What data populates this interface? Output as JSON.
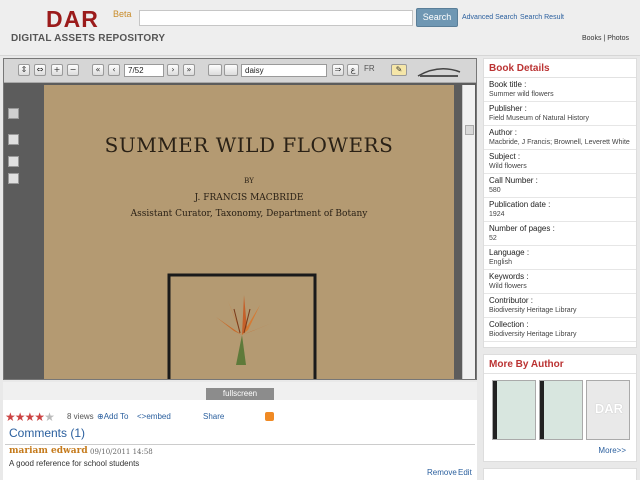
{
  "header": {
    "logo": "DAR",
    "beta": "Beta",
    "subtitle": "DIGITAL ASSETS REPOSITORY",
    "search_value": "",
    "search_button": "Search",
    "advanced_search": "Advanced Search",
    "search_result": "Search Result",
    "books_link": "Books",
    "separator": "|",
    "photos_link": "Photos"
  },
  "viewer": {
    "page_field": "7/52",
    "find_field": "daisy",
    "fr_label": "FR",
    "page": {
      "title": "SUMMER WILD FLOWERS",
      "by": "BY",
      "author": "J. FRANCIS MACBRIDE",
      "position": "Assistant Curator, Taxonomy, Department of Botany"
    },
    "fullscreen_label": "fullscreen"
  },
  "meta": {
    "rating": 4,
    "rating_max": 5,
    "views": "8 views",
    "add_to": "Add To",
    "embed": "embed",
    "share": "Share"
  },
  "comments": {
    "title": "Comments (1)",
    "items": [
      {
        "user": "mariam edward",
        "date": "09/10/2011 14:58",
        "text": "A good reference for school students",
        "remove": "Remove",
        "edit": "Edit"
      }
    ]
  },
  "details": {
    "title": "Book Details",
    "rows": [
      {
        "label": "Book title :",
        "value": "Summer wild flowers"
      },
      {
        "label": "Publisher :",
        "value": "Field Museum of Natural History"
      },
      {
        "label": "Author :",
        "value": "Macbride, J Francis; Brownell, Leverett White"
      },
      {
        "label": "Subject :",
        "value": "Wild flowers"
      },
      {
        "label": "Call Number :",
        "value": "580"
      },
      {
        "label": "Publication date :",
        "value": "1924"
      },
      {
        "label": "Number of pages :",
        "value": "52"
      },
      {
        "label": "Language :",
        "value": "English"
      },
      {
        "label": "Keywords :",
        "value": "Wild flowers"
      },
      {
        "label": "Contributor :",
        "value": "Biodiversity Heritage Library"
      },
      {
        "label": "Collection :",
        "value": "Biodiversity Heritage Library"
      }
    ]
  },
  "more_by_author": {
    "title": "More By Author",
    "thumb_label": "DAR",
    "more_link": "More>>"
  },
  "colors": {
    "brand": "#9b1b1b",
    "link": "#2a5f9e",
    "panel_title": "#b33333",
    "search_button": "#6f97b3"
  }
}
